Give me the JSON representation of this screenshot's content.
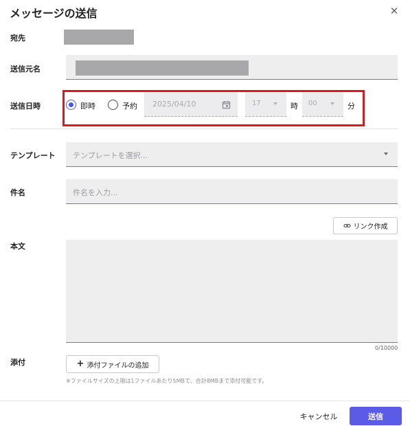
{
  "dialog": {
    "title": "メッセージの送信"
  },
  "to": {
    "label": "宛先"
  },
  "sender": {
    "label": "送信元名"
  },
  "schedule": {
    "label": "送信日時",
    "immediate_label": "即時",
    "scheduled_label": "予約",
    "selected": "即時",
    "date_value": "2025/04/10",
    "hour_value": "17",
    "hour_unit": "時",
    "minute_value": "00",
    "minute_unit": "分"
  },
  "template": {
    "label": "テンプレート",
    "placeholder": "テンプレートを選択..."
  },
  "subject": {
    "label": "件名",
    "placeholder": "件名を入力..."
  },
  "body": {
    "label": "本文",
    "link_button_label": "リンク作成",
    "char_count": "0/10000"
  },
  "attachment": {
    "label": "添付",
    "add_button_label": "添付ファイルの追加",
    "note": "※ファイルサイズの上限は1ファイルあたり5MBで、合計8MBまで添付可能です。"
  },
  "footer": {
    "cancel_label": "キャンセル",
    "send_label": "送信"
  },
  "colors": {
    "accent": "#5a5ce8",
    "highlight": "#e0161b",
    "radio_selected": "#4b55e6"
  },
  "icons": [
    "close-icon",
    "calendar-icon",
    "chevron-down-icon",
    "link-icon",
    "plus-icon"
  ]
}
